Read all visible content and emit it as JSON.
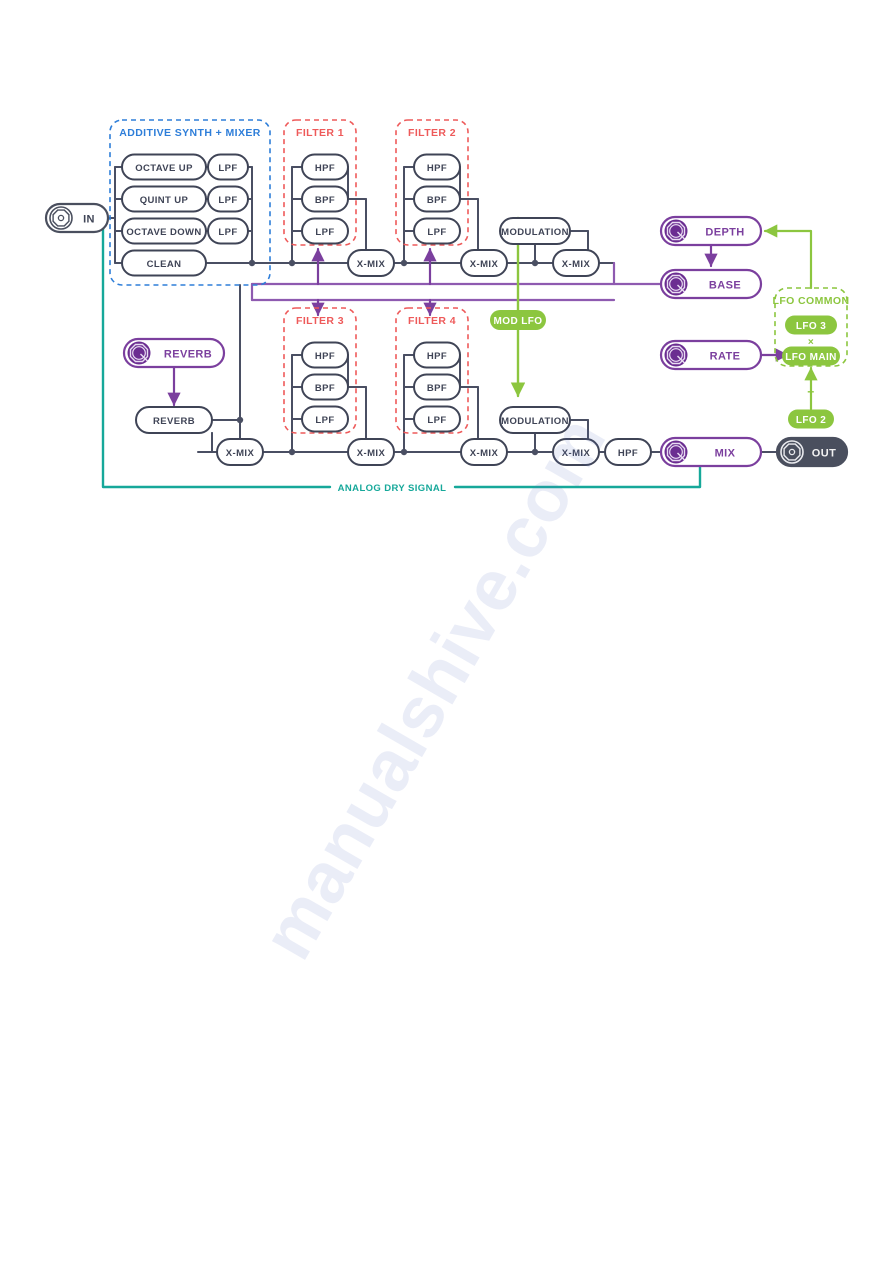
{
  "colors": {
    "signal_line": "#4a4f63",
    "node_stroke": "#3f4456",
    "node_text": "#3f4456",
    "purple": "#7b3f9e",
    "purple_light": "#8e5ab0",
    "green": "#8cc63f",
    "teal": "#16a89a",
    "blue": "#2e7ed9",
    "red": "#ee5a5a",
    "out_fill": "#4a4f5e",
    "out_text": "#f2f2f2",
    "knob_fill": "#6b2d91",
    "white": "#ffffff"
  },
  "jacks": {
    "input": {
      "label": "IN",
      "icon": "input-jack-icon"
    },
    "output": {
      "label": "OUT",
      "icon": "output-jack-icon"
    }
  },
  "groups": {
    "additive": {
      "title": "ADDITIVE SYNTH + MIXER",
      "color": "#2e7ed9",
      "voices": [
        {
          "name": "OCTAVE UP",
          "filter": "LPF"
        },
        {
          "name": "QUINT UP",
          "filter": "LPF"
        },
        {
          "name": "OCTAVE DOWN",
          "filter": "LPF"
        },
        {
          "name": "CLEAN",
          "filter": ""
        }
      ]
    },
    "filter1": {
      "title": "FILTER 1",
      "color": "#ee5a5a",
      "modes": [
        "HPF",
        "BPF",
        "LPF"
      ]
    },
    "filter2": {
      "title": "FILTER 2",
      "color": "#ee5a5a",
      "modes": [
        "HPF",
        "BPF",
        "LPF"
      ]
    },
    "filter3": {
      "title": "FILTER 3",
      "color": "#ee5a5a",
      "modes": [
        "HPF",
        "BPF",
        "LPF"
      ]
    },
    "filter4": {
      "title": "FILTER 4",
      "color": "#ee5a5a",
      "modes": [
        "HPF",
        "BPF",
        "LPF"
      ]
    },
    "lfo_common": {
      "title": "LFO COMMON",
      "color": "#8cc63f",
      "pill_top": "LFO 3",
      "operator": "×",
      "pill_bottom": "LFO MAIN"
    }
  },
  "mixers": {
    "top": [
      "X-MIX",
      "X-MIX",
      "X-MIX"
    ],
    "bottom": [
      "X-MIX",
      "X-MIX",
      "X-MIX",
      "X-MIX"
    ]
  },
  "blocks": {
    "modulation_top": "MODULATION",
    "modulation_bottom": "MODULATION",
    "reverb_block": "REVERB",
    "hpf_out": "HPF"
  },
  "knobs": [
    {
      "id": "reverb",
      "label": "REVERB"
    },
    {
      "id": "depth",
      "label": "DEPTH"
    },
    {
      "id": "base",
      "label": "BASE"
    },
    {
      "id": "rate",
      "label": "RATE"
    },
    {
      "id": "mix",
      "label": "MIX"
    }
  ],
  "tags": {
    "mod_lfo": "MOD LFO",
    "lfo_2": "LFO 2",
    "analog_dry": "ANALOG DRY SIGNAL"
  },
  "watermark": {
    "line1": "manualshive.com"
  }
}
